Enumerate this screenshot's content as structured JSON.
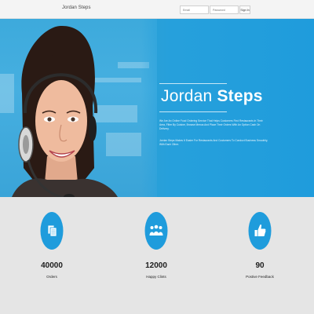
{
  "navbar": {
    "brand": "Jordan Steps",
    "email_placeholder": "Email",
    "password_placeholder": "Password",
    "signin_label": "Sign In"
  },
  "hero": {
    "title_light": "Jordan ",
    "title_bold": "Steps",
    "paragraph_1": "We Are An Online Food Ordering Service That Helps Customers Find Restaurants In Their Area, Filter By Cuisine, Browse Menus And Place Their Orders With An Option Cash On Delivery.",
    "paragraph_2": "Jordan Steps Makes It Easier For Restaurants And Customers To Conduct Business Smoothly, With Each Other."
  },
  "stats": [
    {
      "value": "40000",
      "label": "Orders",
      "icon": "documents-icon"
    },
    {
      "value": "12000",
      "label": "Happy Clints",
      "icon": "users-icon"
    },
    {
      "value": "90",
      "label": "Postive Feedback",
      "icon": "thumbs-up-icon"
    }
  ],
  "colors": {
    "accent": "#1f9cdc",
    "stats_background": "#e5e5e5",
    "navbar_background": "#f4f4f4"
  }
}
